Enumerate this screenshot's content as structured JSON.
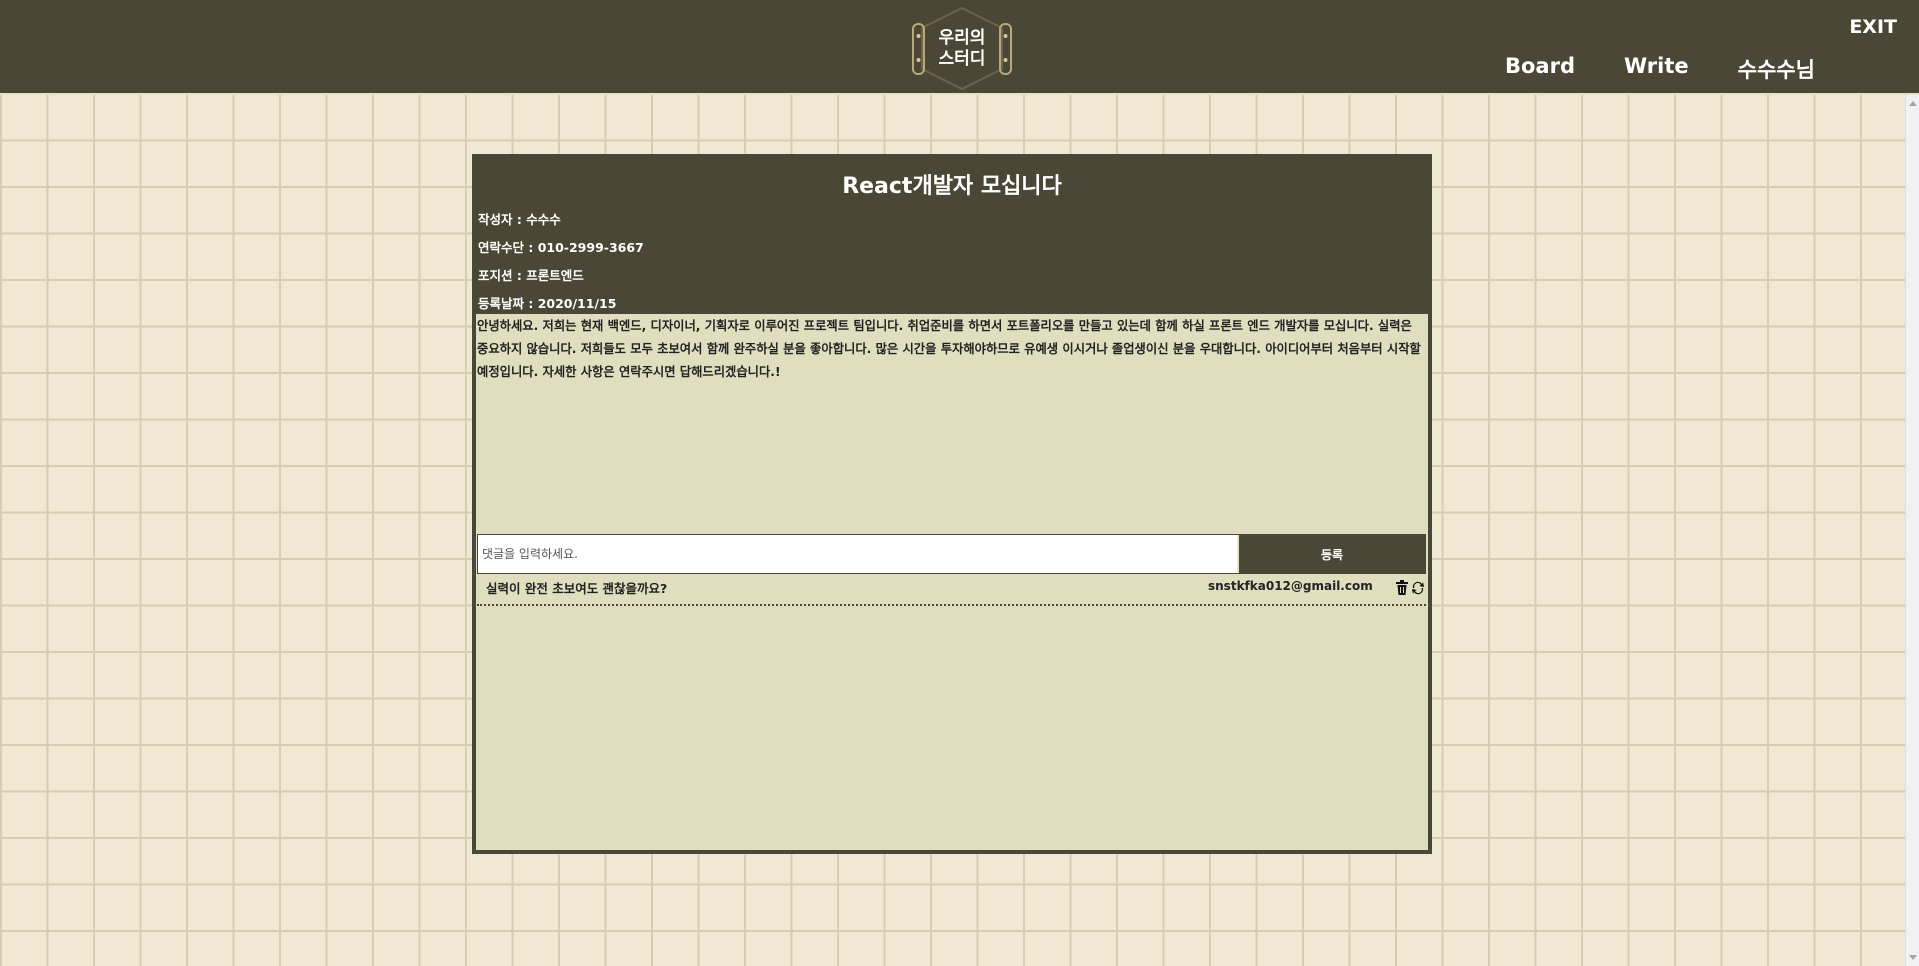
{
  "header": {
    "logo_text_top": "우리의",
    "logo_text_bottom": "스터디",
    "exit_label": "EXIT",
    "nav": [
      "Board",
      "Write",
      "수수수님"
    ]
  },
  "post": {
    "title": "React개발자 모십니다",
    "author": "작성자 : 수수수",
    "contact": "연락수단 : 010-2999-3667",
    "position": "포지션 : 프론트엔드",
    "date": "등록날짜 : 2020/11/15",
    "body": "안녕하세요. 저희는 현재 백엔드, 디자이너, 기획자로 이루어진 프로젝트 팀입니다. 취업준비를 하면서 포트폴리오를 만들고 있는데 함께 하실 프론트 엔드 개발자를 모십니다. 실력은 중요하지 않습니다. 저희들도 모두 초보여서 함께 완주하실 분을 좋아합니다. 많은 시간을 투자해야하므로 유예생 이시거나 졸업생이신 분을 우대합니다. 아이디어부터 처음부터 시작할 예정입니다. 자세한 사항은 연락주시면 답해드리겠습니다.!"
  },
  "comment_form": {
    "placeholder": "댓글을 입력하세요.",
    "submit_label": "등록"
  },
  "comments": [
    {
      "text": "실력이 완전 초보여도 괜찮을까요?",
      "email": "snstkfka012@gmail.com"
    }
  ],
  "colors": {
    "header_bg": "#4b4736",
    "page_bg": "#efe8d2",
    "content_bg": "#dfdfc0"
  }
}
